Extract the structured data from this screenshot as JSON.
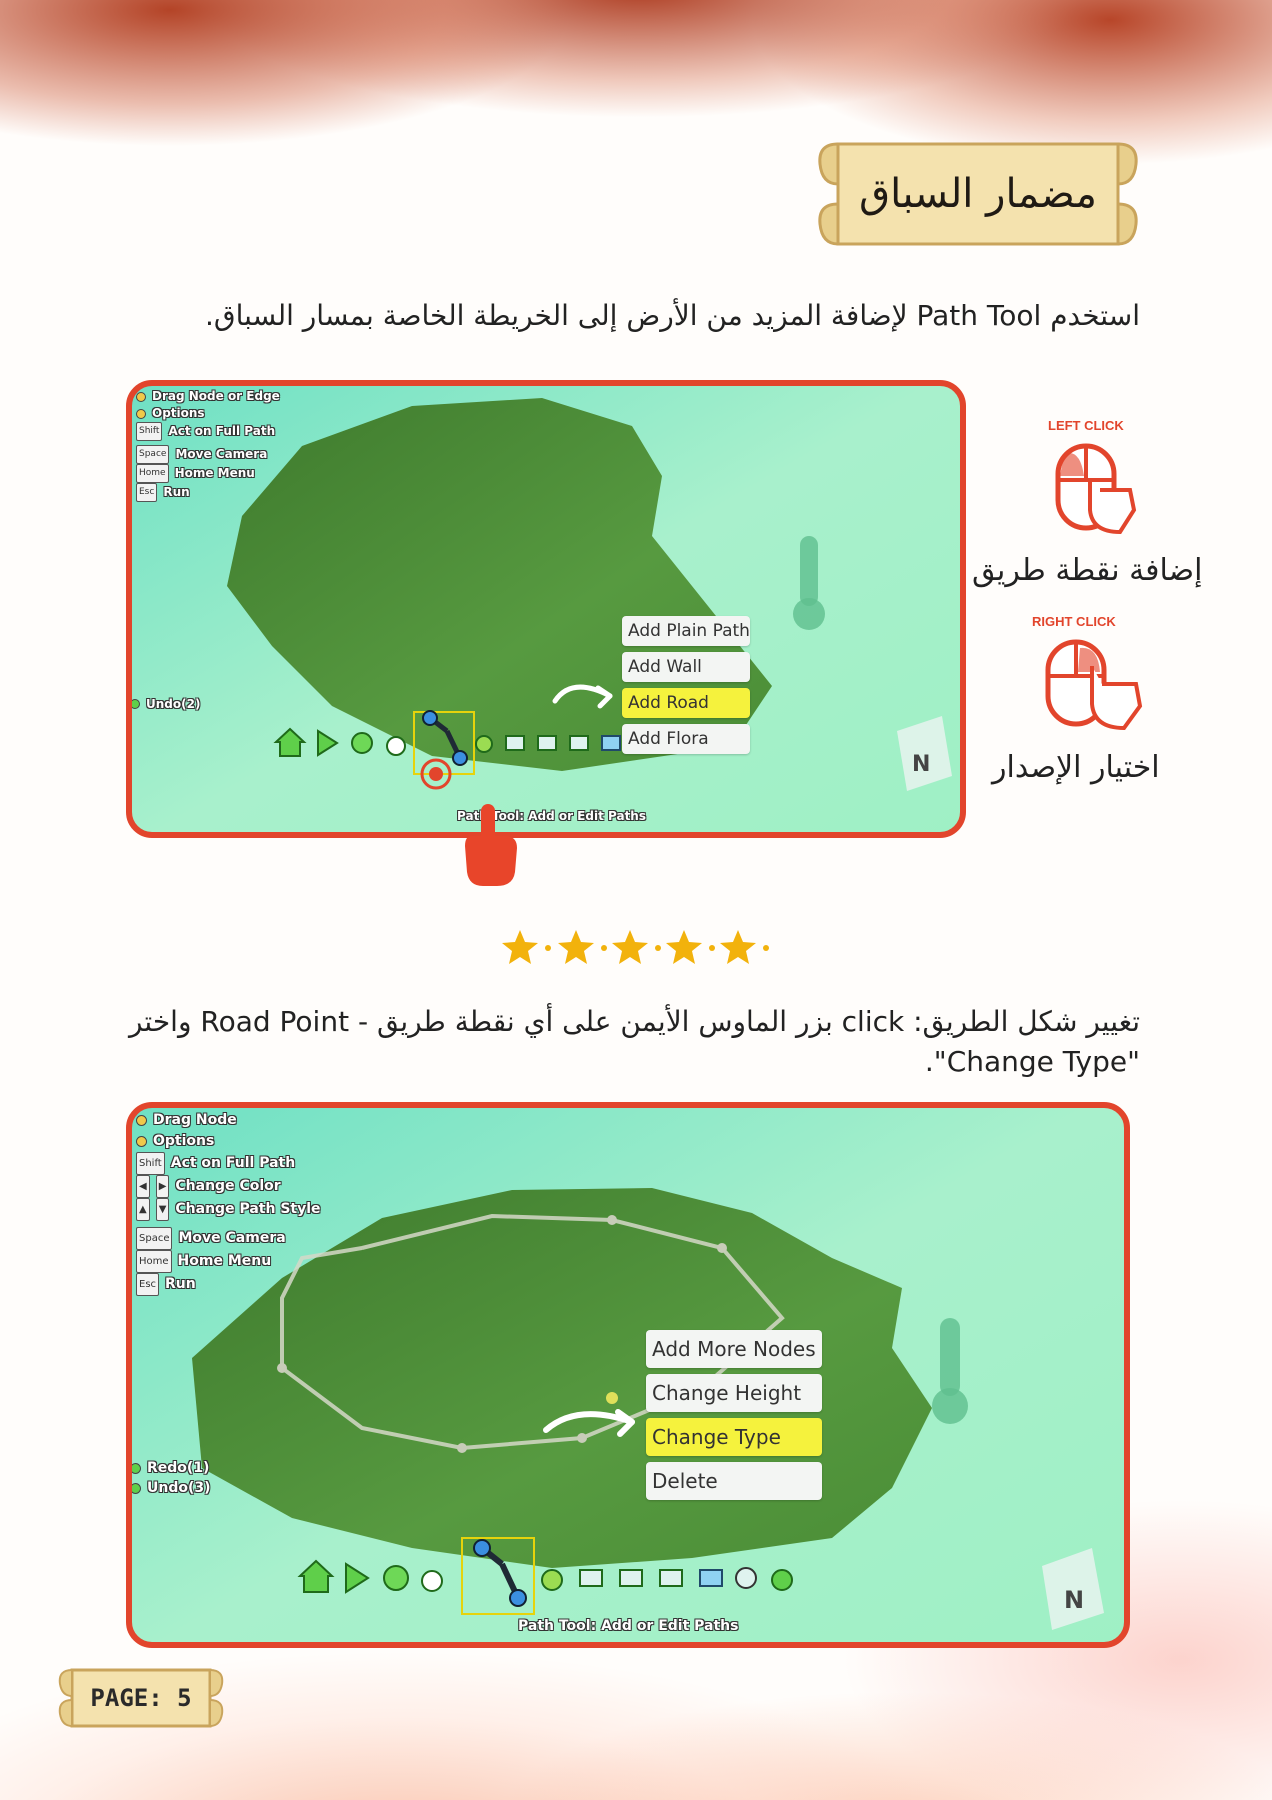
{
  "page": {
    "title": "مضمار السباق",
    "intro": "استخدم Path Tool لإضافة المزيد من الأرض إلى الخريطة الخاصة بمسار السباق.",
    "instruction": "تغيير شكل الطريق: click بزر الماوس الأيمن على أي نقطة طريق - Road Point واختر \"Change Type\".",
    "page_label": "PAGE: 5"
  },
  "screenshot1": {
    "hud": [
      "Drag Node or Edge",
      "Options",
      "Act on Full Path",
      "Move Camera",
      "Home Menu",
      "Run"
    ],
    "keys": [
      "Shift",
      "Space",
      "Home",
      "Esc"
    ],
    "undo": "Undo(2)",
    "menu": [
      "Add Plain Path",
      "Add Wall",
      "Add Road",
      "Add Flora"
    ],
    "highlighted": "Add Road",
    "toolbar_label": "Path Tool: Add or Edit Paths",
    "compass": "N"
  },
  "legend": {
    "left_click": "LEFT CLICK",
    "left_action": "إضافة نقطة طريق",
    "right_click": "RIGHT CLICK",
    "right_action": "اختيار الإصدار"
  },
  "screenshot2": {
    "hud": [
      "Drag Node",
      "Options",
      "Act on Full Path",
      "Change Color",
      "Change Path Style",
      "Move Camera",
      "Home Menu",
      "Run"
    ],
    "keys": [
      "Shift",
      "Space",
      "Home",
      "Esc"
    ],
    "redo": "Redo(1)",
    "undo": "Undo(3)",
    "menu": [
      "Add More Nodes",
      "Change Height",
      "Change Type",
      "Delete"
    ],
    "highlighted": "Change Type",
    "toolbar_label": "Path Tool: Add or Edit Paths",
    "compass": "N"
  },
  "colors": {
    "accent": "#e2452c",
    "highlight": "#f5f23d",
    "terrain": "#4f8f3a",
    "star": "#f2b20c"
  }
}
